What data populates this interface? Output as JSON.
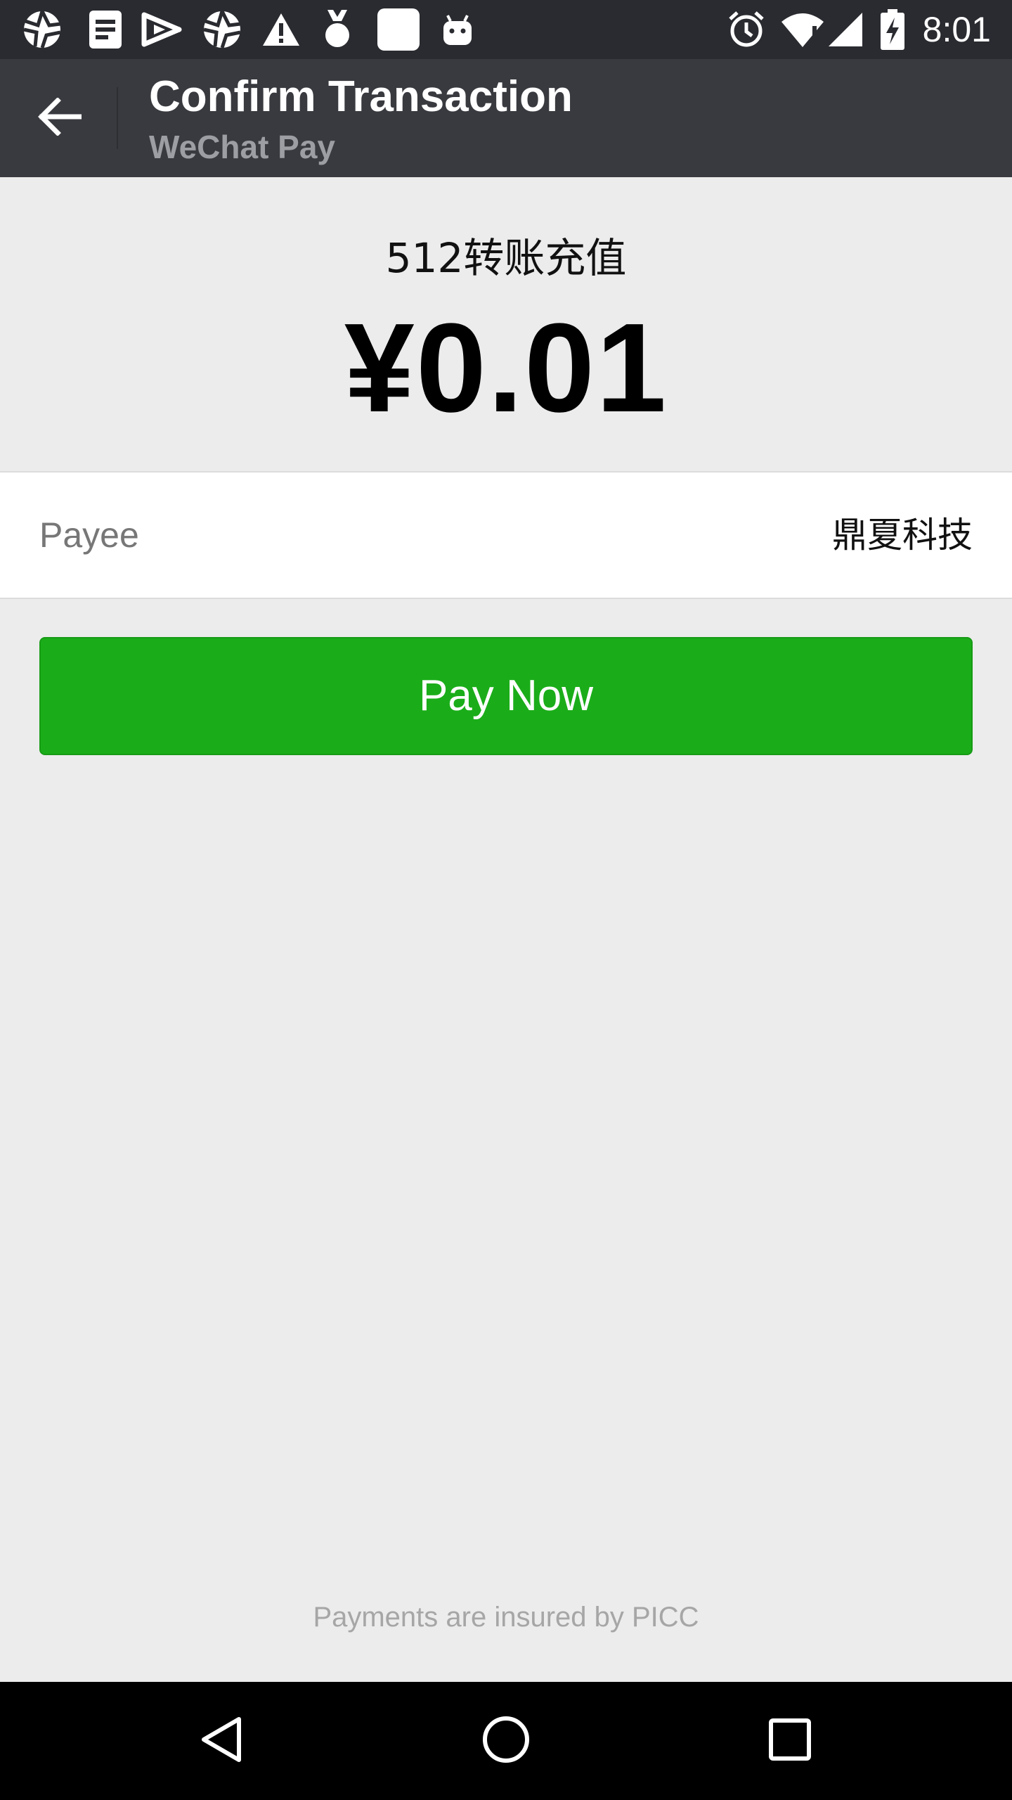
{
  "status_bar": {
    "time": "8:01",
    "left_icons": [
      "aperture-icon",
      "document-icon",
      "play-icon",
      "aperture-icon",
      "warning-icon",
      "medal-icon",
      "square-app-icon",
      "android-icon"
    ],
    "right_icons": [
      "alarm-icon",
      "wifi-icon",
      "signal-icon",
      "battery-charging-icon"
    ]
  },
  "app_bar": {
    "title": "Confirm Transaction",
    "subtitle": "WeChat Pay",
    "back_icon": "back-arrow-icon"
  },
  "order": {
    "product_name": "512转账充值",
    "amount": "¥0.01"
  },
  "payee": {
    "label": "Payee",
    "value": "鼎夏科技"
  },
  "pay_button": {
    "label": "Pay Now"
  },
  "footer": {
    "insured_text": "Payments are insured by PICC"
  },
  "nav_bar": {
    "buttons": [
      "back-triangle-icon",
      "home-circle-icon",
      "recents-square-icon"
    ]
  },
  "colors": {
    "status_bar_bg": "#2a2b30",
    "app_bar_bg": "#393a3f",
    "page_bg": "#ececec",
    "accent_green": "#1aad19",
    "nav_bar_bg": "#000000"
  }
}
